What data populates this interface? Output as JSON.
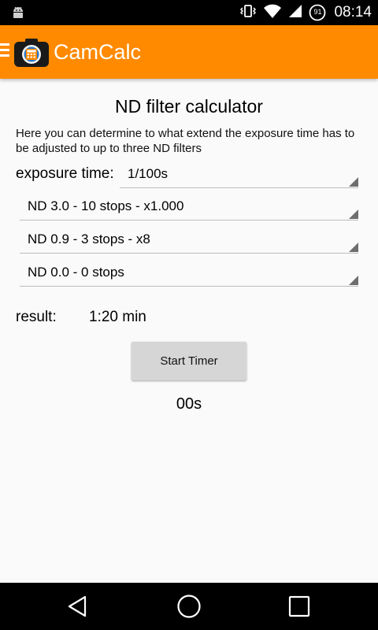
{
  "status_bar": {
    "time": "08:14",
    "battery_level": "91",
    "icons": [
      "android-debug-icon",
      "vibrate-icon",
      "wifi-icon",
      "signal-icon",
      "battery-icon"
    ]
  },
  "app_bar": {
    "title": "CamCalc",
    "accent_color": "#ff8a00"
  },
  "main": {
    "page_title": "ND filter calculator",
    "description": "Here you can determine to what extend the exposure time has to be adjusted to up to three ND filters",
    "exposure_label": "exposure time:",
    "exposure_value": "1/100s",
    "filters": [
      "ND 3.0 - 10 stops - x1.000",
      "ND 0.9 - 3 stops - x8",
      "ND 0.0 - 0 stops"
    ],
    "result_label": "result:",
    "result_value": "1:20 min",
    "timer_button_label": "Start Timer",
    "timer_display": "00s"
  },
  "nav_bar": {
    "icons": [
      "back-icon",
      "home-icon",
      "recents-icon"
    ]
  }
}
